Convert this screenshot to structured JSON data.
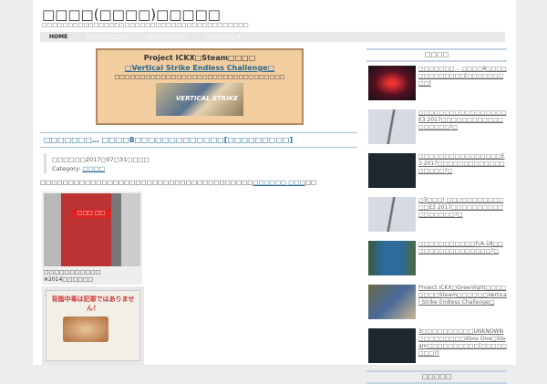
{
  "site": {
    "title": "□□□□(□□□□)□□□□□",
    "tagline": "□□□□□□□□□□□□□□□□□□□□□□□□□□□□□□□□□□□□□□□□"
  },
  "nav": [
    "HOME",
    "□□□□□□□□",
    "□□□□□□□□",
    "□□□□□□ ▾"
  ],
  "banner": {
    "line1": "Project ICKX□Steam□□□□",
    "line2": "□Vertical Strike Endless Challenge□",
    "line3": "□□□□□□□□□□□□□□□□□□□□□□□□□□□□□□□□□",
    "img_text": "VERTICAL STRIKE"
  },
  "post": {
    "title": "□□□□□□□… □□□□8□□□□□□□□□□□□□[□□□□□□□□□]",
    "date": "□□□□□□2017□07□31□□□□",
    "category_label": "Category:",
    "category": "□□□□",
    "body_text": "□□□□□□□□□□□□□□□□□□□□□□□□□□□□□□□□□□□□□□",
    "body_link": "□□□□□□ □□□",
    "body_end": "□□",
    "img1_sign": "□□□ □□",
    "caption1": "□□□□□□□□□□□",
    "caption2": "※2014□□□□□□",
    "img2_text": "背脂中毒は犯罪ではありません！"
  },
  "sidebar": {
    "heading": "□□□□",
    "items": [
      "□□□□□□□… □□□□8□□□□□□□□□□□□□[□□□□□□□□□]",
      "□□□□□□□□□□□□□□□□□E3 2017□□□□□□□□□□□□□□□□□□?□",
      "□□□□□□□□□□□□□□□□E3 2017□□□□□□□□□□□□□□□□□□?□",
      "□3□□□! □□□□□□□□□□□□□E3 2017□□□□□□□□□□□□□□□□□?□",
      "□□□□□□□□□□□F/A-18□□□□□□□□□□□□□□□□?□",
      "Project ICKX□Greenlight□□□□□□□□Steam□□□□□□Vertical Strike Endless Challenge□",
      "3□□□□□□□□□□UNKNOWN□□□□□□□□□Xbox One□Steam□□□□□□□□□□[□□□□□□□□?]"
    ],
    "heading2": "□□□□□"
  }
}
